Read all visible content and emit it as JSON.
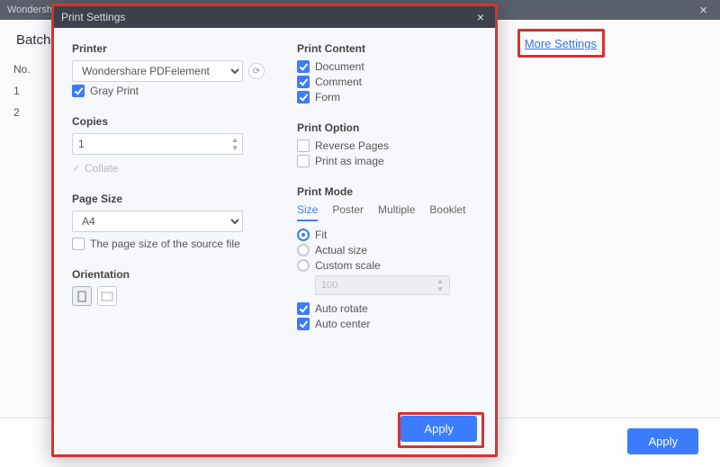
{
  "app": {
    "title": "Wondersha"
  },
  "bg": {
    "header": "Batch",
    "more": "More Settings",
    "cols": {
      "no": "No."
    },
    "rows": [
      "1",
      "2"
    ],
    "apply": "Apply"
  },
  "modal": {
    "title": "Print Settings",
    "left": {
      "printer": {
        "label": "Printer",
        "value": "Wondershare PDFelement",
        "gray": "Gray Print"
      },
      "copies": {
        "label": "Copies",
        "value": "1",
        "collate": "Collate"
      },
      "pagesize": {
        "label": "Page Size",
        "value": "A4",
        "source": "The page size of the source file"
      },
      "orientation": {
        "label": "Orientation"
      }
    },
    "right": {
      "content": {
        "label": "Print Content",
        "document": "Document",
        "comment": "Comment",
        "form": "Form"
      },
      "option": {
        "label": "Print Option",
        "reverse": "Reverse Pages",
        "asimage": "Print as image"
      },
      "mode": {
        "label": "Print Mode",
        "tabs": {
          "size": "Size",
          "poster": "Poster",
          "multiple": "Multiple",
          "booklet": "Booklet"
        },
        "fit": "Fit",
        "actual": "Actual size",
        "custom": "Custom scale",
        "scaleval": "100",
        "autorotate": "Auto rotate",
        "autocenter": "Auto center"
      }
    },
    "apply": "Apply"
  }
}
